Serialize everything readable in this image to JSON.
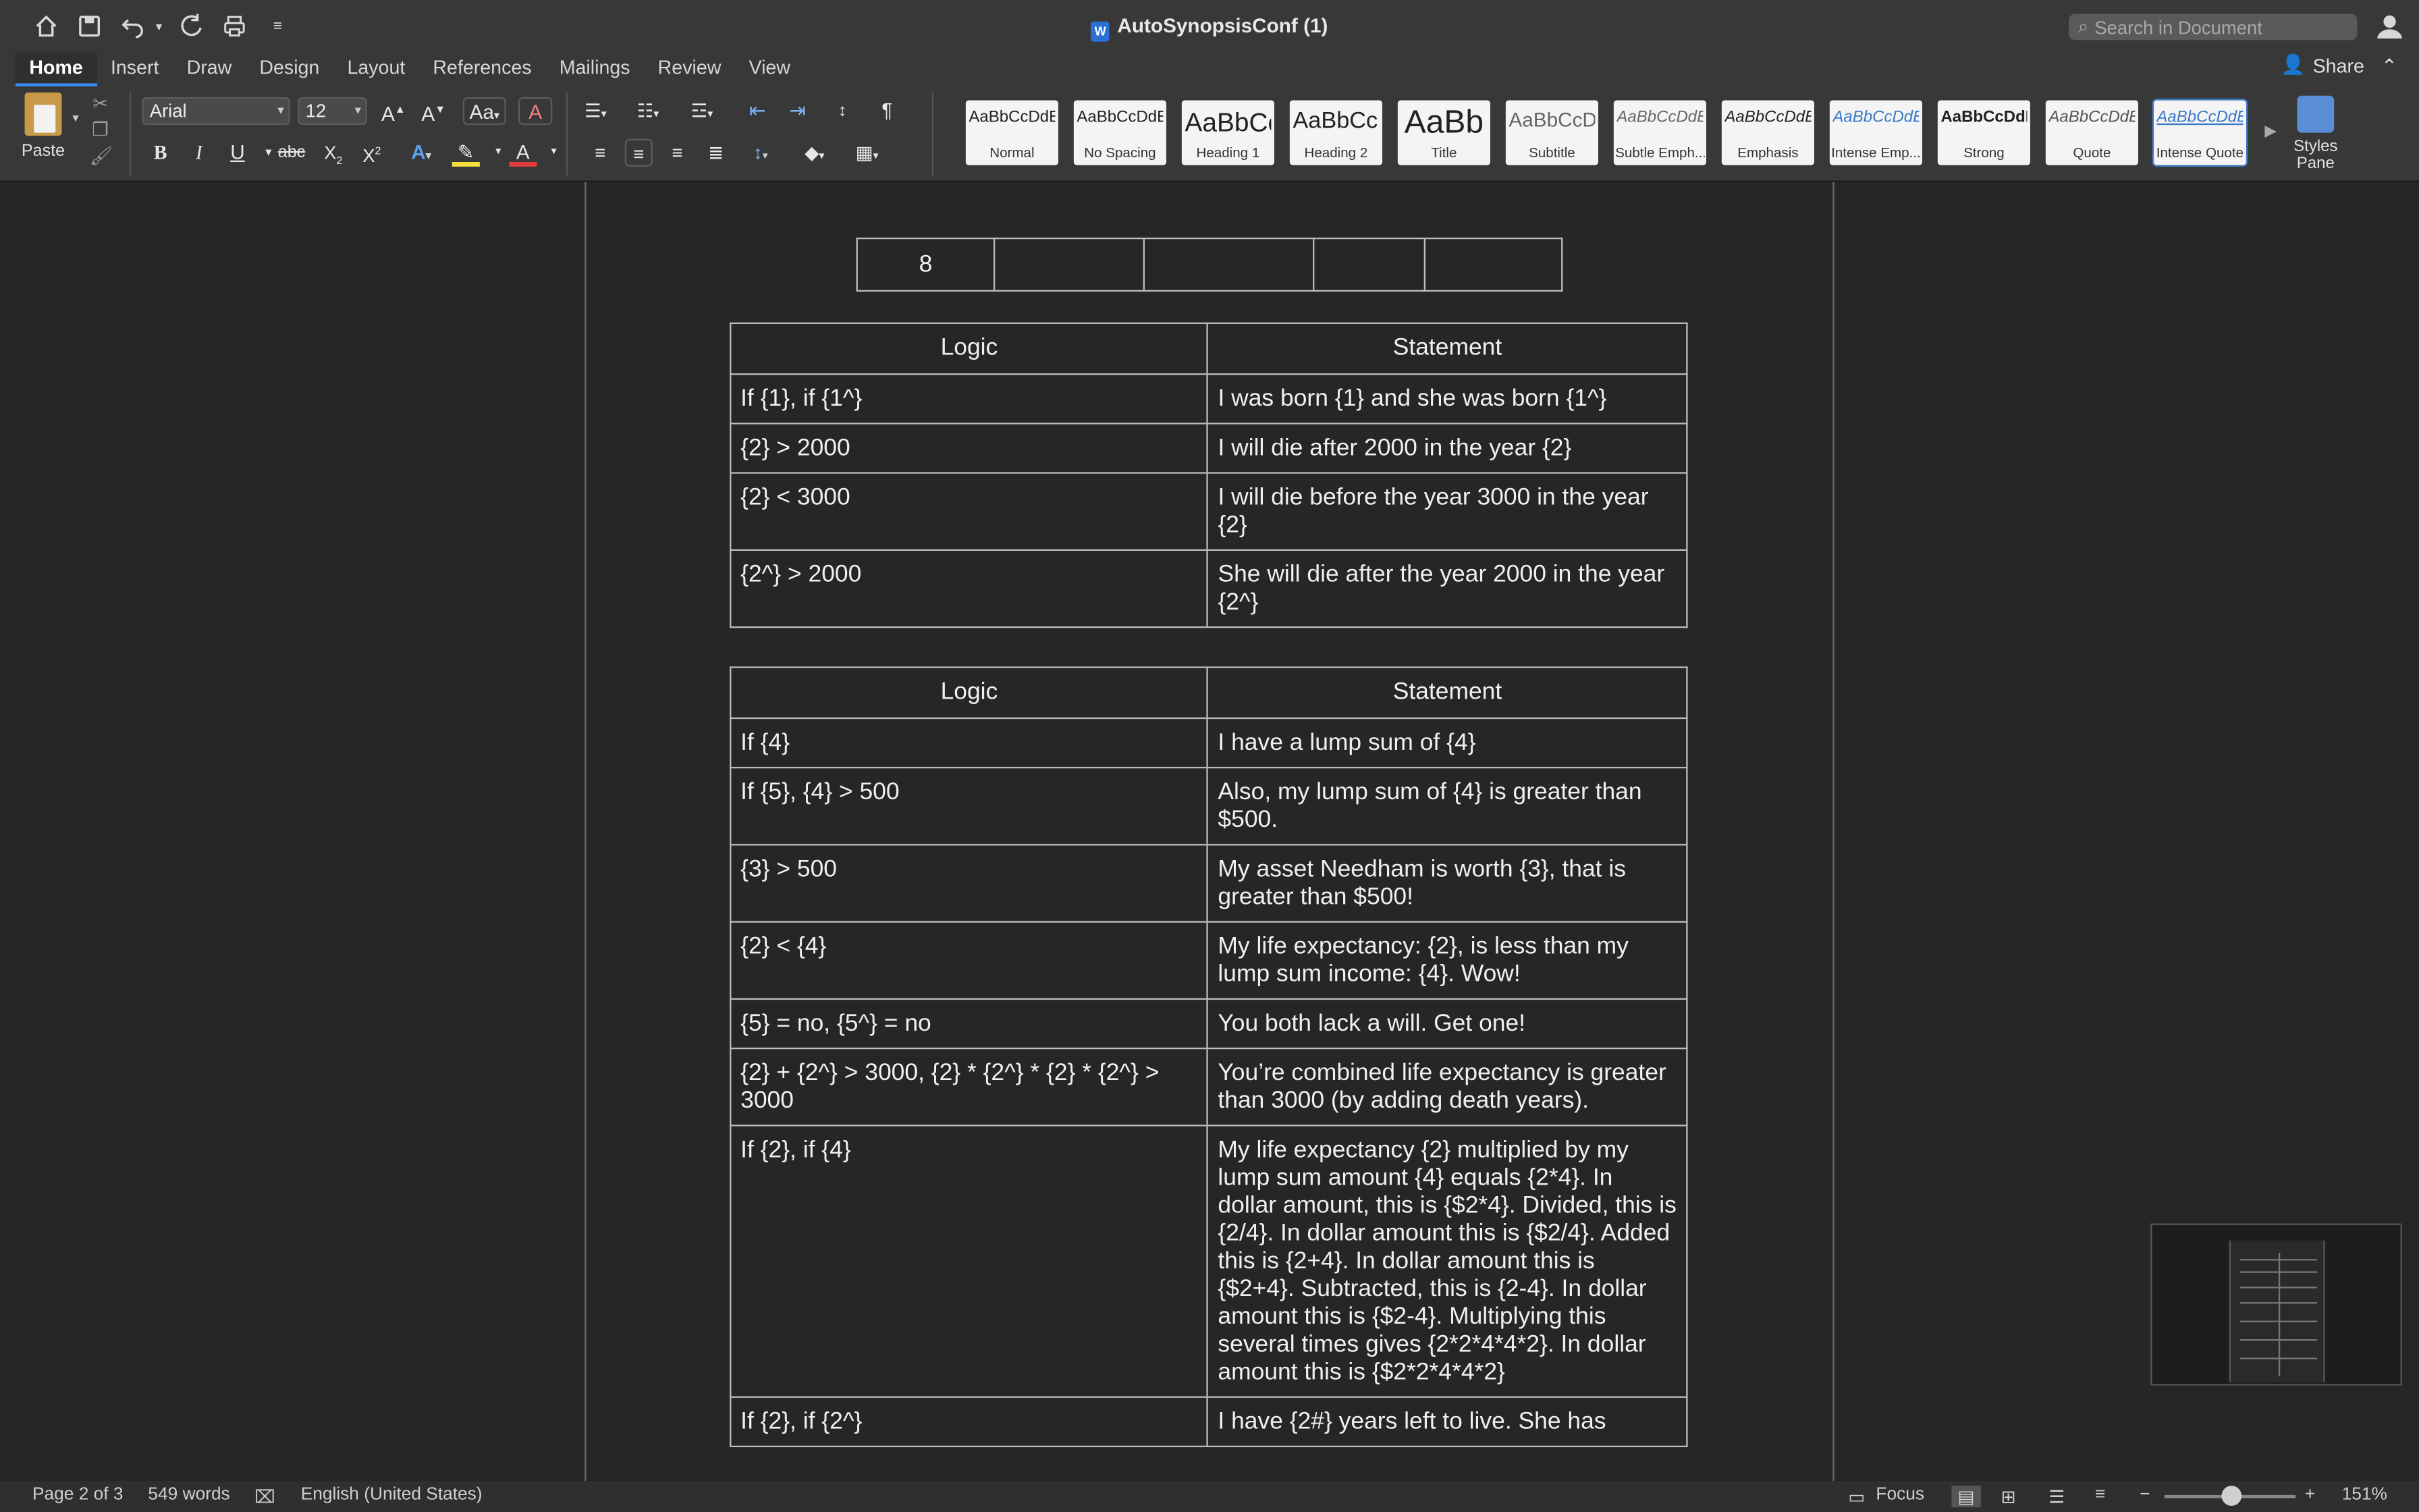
{
  "window": {
    "title": "AutoSynopsisConf (1)"
  },
  "search": {
    "placeholder": "Search in Document"
  },
  "ribbon_tabs": [
    "Home",
    "Insert",
    "Draw",
    "Design",
    "Layout",
    "References",
    "Mailings",
    "Review",
    "View"
  ],
  "share_label": "Share",
  "clipboard": {
    "paste_label": "Paste"
  },
  "font": {
    "name": "Arial",
    "size": "12"
  },
  "styles_gallery": [
    {
      "sample": "AaBbCcDdEe",
      "name": "Normal"
    },
    {
      "sample": "AaBbCcDdEe",
      "name": "No Spacing"
    },
    {
      "sample": "AaBbCc",
      "name": "Heading 1"
    },
    {
      "sample": "AaBbCcI",
      "name": "Heading 2"
    },
    {
      "sample": "AaBb",
      "name": "Title"
    },
    {
      "sample": "AaBbCcD",
      "name": "Subtitle"
    },
    {
      "sample": "AaBbCcDdEe",
      "name": "Subtle Emph..."
    },
    {
      "sample": "AaBbCcDdEe",
      "name": "Emphasis"
    },
    {
      "sample": "AaBbCcDdEe",
      "name": "Intense Emp..."
    },
    {
      "sample": "AaBbCcDdE",
      "name": "Strong"
    },
    {
      "sample": "AaBbCcDdEe",
      "name": "Quote"
    },
    {
      "sample": "AaBbCcDdEe",
      "name": "Intense Quote"
    }
  ],
  "styles_pane_label": "Styles Pane",
  "document": {
    "top_table_first_cell": "8",
    "table1": {
      "headers": [
        "Logic",
        "Statement"
      ],
      "rows": [
        [
          "If {1}, if {1^}",
          "I was born {1} and she was born {1^}"
        ],
        [
          "{2} > 2000",
          "I will die after 2000 in the year {2}"
        ],
        [
          "{2} < 3000",
          "I will die before the year 3000 in the year {2}"
        ],
        [
          "{2^} > 2000",
          "She will die after the year 2000 in the year {2^}"
        ]
      ]
    },
    "table2": {
      "headers": [
        "Logic",
        "Statement"
      ],
      "rows": [
        [
          "If {4}",
          "I have a lump sum of {4}"
        ],
        [
          "If {5}, {4} > 500",
          "Also, my lump sum of {4} is greater than $500."
        ],
        [
          "{3} > 500",
          "My asset Needham is worth {3}, that is greater than $500!"
        ],
        [
          "{2} < {4}",
          "My life expectancy: {2}, is less than my lump sum income: {4}. Wow!"
        ],
        [
          "{5} = no, {5^} = no",
          "You both lack a will. Get one!"
        ],
        [
          "{2} + {2^} > 3000, {2} * {2^} * {2} * {2^} > 3000",
          "You’re combined life expectancy is greater than 3000 (by adding death years)."
        ],
        [
          "If {2}, if {4}",
          "My life expectancy {2} multiplied by my lump sum amount {4} equals {2*4}. In dollar amount, this is {$2*4}. Divided, this is {2/4}. In dollar amount this is {$2/4}. Added this is {2+4}. In dollar amount this is {$2+4}. Subtracted, this is {2-4}. In dollar amount this is {$2-4}. Multiplying this several times gives {2*2*4*4*2}. In dollar amount this is {$2*2*4*4*2}"
        ],
        [
          "If {2}, if {2^}",
          "I have {2#} years left to live. She has"
        ]
      ]
    }
  },
  "status": {
    "page": "Page 2 of 3",
    "words": "549 words",
    "language": "English (United States)",
    "focus": "Focus",
    "zoom": "151%",
    "zoom_level": 0.51
  }
}
